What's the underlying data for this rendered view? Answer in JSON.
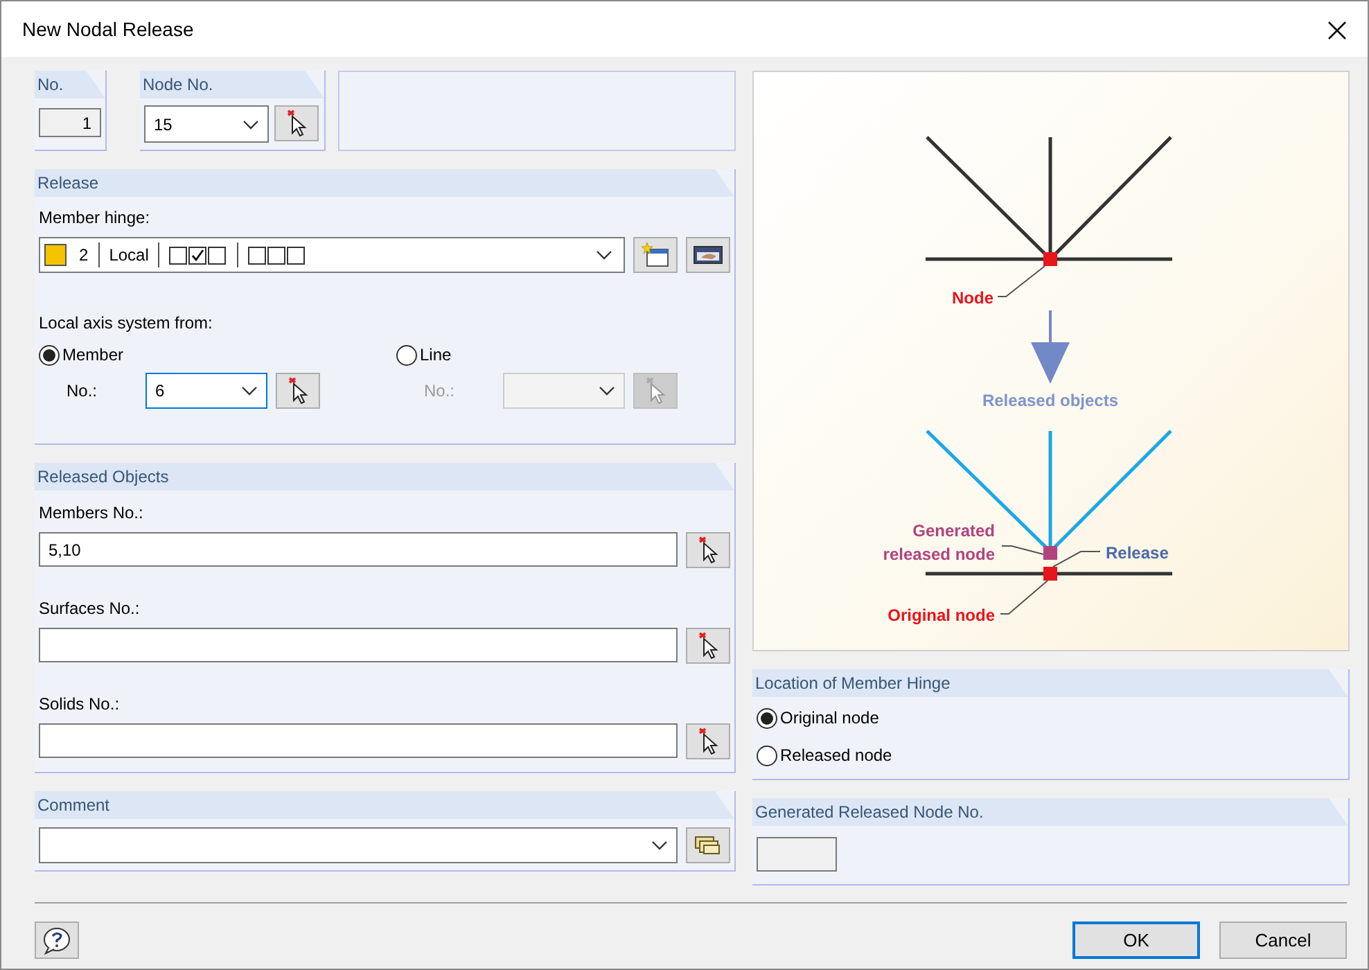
{
  "window": {
    "title": "New Nodal Release"
  },
  "number": {
    "title": "No.",
    "value": "1"
  },
  "node": {
    "title": "Node No.",
    "value": "15"
  },
  "release": {
    "title": "Release",
    "hinge_label": "Member hinge:",
    "hinge": {
      "number": "2",
      "color": "#f5c400",
      "system": "Local",
      "groups": [
        [
          {
            "checked": false
          },
          {
            "checked": true
          },
          {
            "checked": false
          }
        ],
        [
          {
            "checked": false
          },
          {
            "checked": false
          },
          {
            "checked": false
          }
        ]
      ]
    },
    "axis_label": "Local axis system from:",
    "axis_options": [
      {
        "label": "Member",
        "selected": true,
        "no_label": "No.:",
        "value": "6",
        "disabled": false
      },
      {
        "label": "Line",
        "selected": false,
        "no_label": "No.:",
        "disabled": true
      }
    ]
  },
  "released_objects": {
    "title": "Released Objects",
    "fields": [
      {
        "label": "Members No.:",
        "value": "5,10"
      },
      {
        "label": "Surfaces No.:"
      },
      {
        "label": "Solids No.:"
      }
    ]
  },
  "comment": {
    "title": "Comment"
  },
  "diagram": {
    "node": "Node",
    "released_objects": "Released objects",
    "generated": "Generated released node",
    "release": "Release",
    "original": "Original node"
  },
  "location": {
    "title": "Location of Member Hinge",
    "options": [
      {
        "label": "Original node",
        "selected": true
      },
      {
        "label": "Released node",
        "selected": false
      }
    ]
  },
  "generated": {
    "title": "Generated Released Node No."
  },
  "buttons": [
    {
      "label": "OK",
      "default": true
    },
    {
      "label": "Cancel",
      "default": false
    }
  ]
}
